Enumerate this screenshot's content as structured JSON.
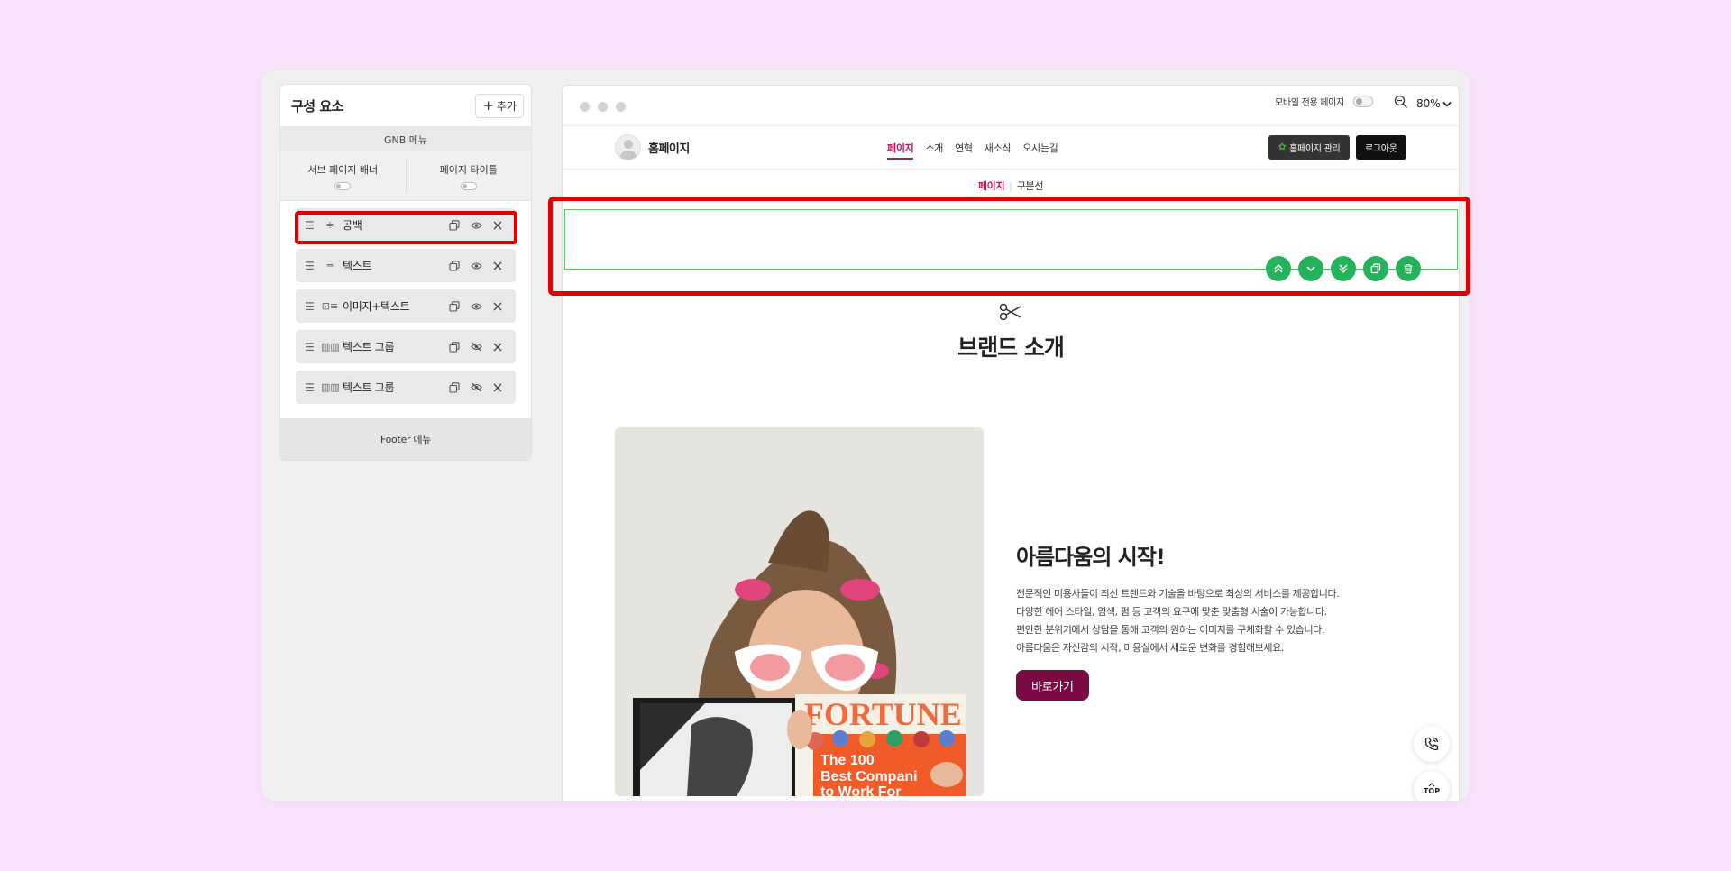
{
  "panel": {
    "title": "구성 요소",
    "add_label": "추가",
    "gnb_label": "GNB 메뉴",
    "sub_banner_label": "서브 페이지 배너",
    "page_title_label": "페이지 타이틀",
    "components": [
      {
        "label": "공백",
        "type_icon": "spacer-icon",
        "visible": true
      },
      {
        "label": "텍스트",
        "type_icon": "text-icon",
        "visible": true
      },
      {
        "label": "이미지+텍스트",
        "type_icon": "image-text-icon",
        "visible": true
      },
      {
        "label": "텍스트 그룹",
        "type_icon": "text-group-icon",
        "visible": false
      },
      {
        "label": "텍스트 그룹",
        "type_icon": "text-group-icon",
        "visible": false
      }
    ],
    "footer_label": "Footer 메뉴"
  },
  "preview": {
    "mobile_label": "모바일 전용 페이지",
    "zoom": "80%",
    "site": {
      "name": "홈페이지",
      "nav": [
        "페이지",
        "소개",
        "연혁",
        "새소식",
        "오시는길"
      ],
      "active_nav": "페이지",
      "admin_label": "홈페이지 관리",
      "logout_label": "로그아웃"
    },
    "breadcrumb": {
      "current": "페이지",
      "sep": "|",
      "next": "구분선"
    },
    "section_title": "브랜드 소개",
    "intro_title": "아름다움의 시작!",
    "intro_lines": [
      "전문적인 미용사들이 최신 트렌드와 기술을 바탕으로 최상의 서비스를 제공합니다.",
      "다양한 헤어 스타일, 염색, 펌 등 고객의 요구에 맞춘 맞춤형 시술이 가능합니다.",
      "편안한 분위기에서 상담을 통해 고객의 원하는 이미지를 구체화할 수 있습니다.",
      "아름다움은 자신감의 시작, 미용실에서 새로운 변화를 경험해보세요."
    ],
    "cta_label": "바로가기",
    "magazine_title": "FORTUNE",
    "magazine_lines": [
      "The 100",
      "Best Compani",
      "to Work For"
    ],
    "top_label": "TOP"
  },
  "colors": {
    "background": "#f9e3fb",
    "accent_nav": "#c2185b",
    "cta": "#7a0b42",
    "tool_green": "#26b25a",
    "highlight": "#e00000"
  }
}
